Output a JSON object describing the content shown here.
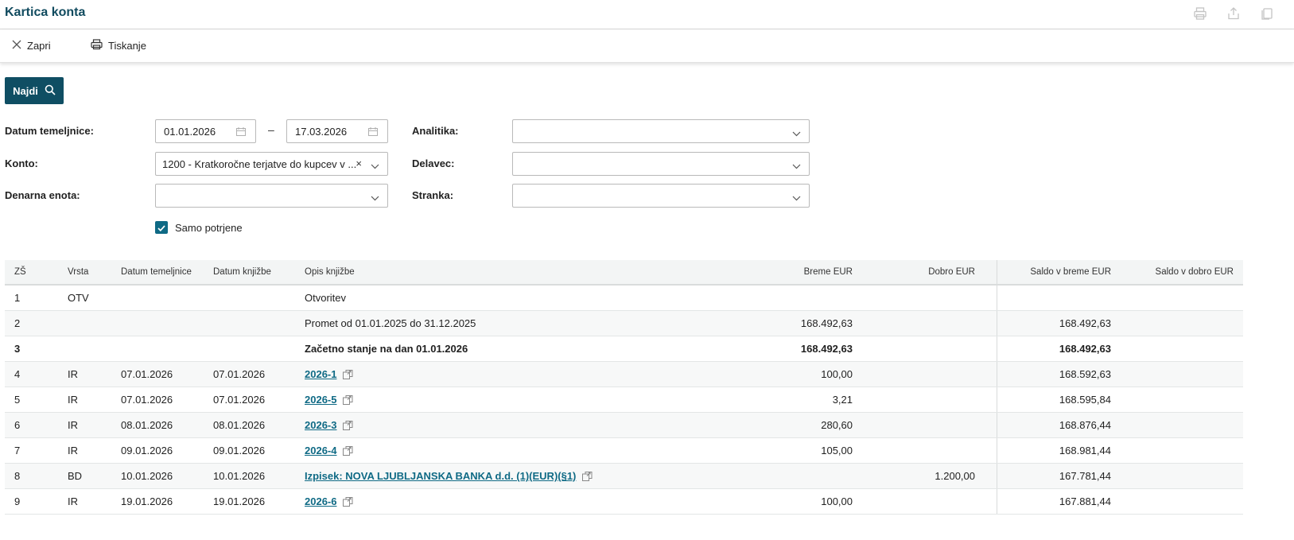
{
  "header": {
    "title": "Kartica konta",
    "icons": [
      "print-icon",
      "share-icon",
      "copy-icon"
    ]
  },
  "toolbar": {
    "close_label": "Zapri",
    "print_label": "Tiskanje"
  },
  "find_label": "Najdi",
  "filters": {
    "datum_label": "Datum temeljnice:",
    "date_from": "01.01.2026",
    "date_sep": "–",
    "date_to": "17.03.2026",
    "konto_label": "Konto:",
    "konto_value": "1200 - Kratkoročne terjatve do kupcev v ...",
    "clear_symbol": "×",
    "denarna_label": "Denarna enota:",
    "denarna_value": "",
    "analitika_label": "Analitika:",
    "analitika_value": "",
    "delavec_label": "Delavec:",
    "delavec_value": "",
    "stranka_label": "Stranka:",
    "stranka_value": "",
    "samo_potrjene_label": "Samo potrjene",
    "samo_potrjene_checked": true
  },
  "table": {
    "headers": {
      "zs": "ZŠ",
      "vrsta": "Vrsta",
      "datum_temeljnice": "Datum temeljnice",
      "datum_knjizbe": "Datum knjižbe",
      "opis": "Opis knjižbe",
      "breme": "Breme EUR",
      "dobro": "Dobro EUR",
      "saldo_breme": "Saldo v breme EUR",
      "saldo_dobro": "Saldo v dobro EUR"
    },
    "rows": [
      {
        "zs": "1",
        "vrsta": "OTV",
        "datum_temeljnice": "",
        "datum_knjizbe": "",
        "opis": "Otvoritev",
        "link": false,
        "breme": "",
        "dobro": "",
        "saldo_breme": "",
        "saldo_dobro": "",
        "bold": false
      },
      {
        "zs": "2",
        "vrsta": "",
        "datum_temeljnice": "",
        "datum_knjizbe": "",
        "opis": "Promet od 01.01.2025 do 31.12.2025",
        "link": false,
        "breme": "168.492,63",
        "dobro": "",
        "saldo_breme": "168.492,63",
        "saldo_dobro": "",
        "bold": false
      },
      {
        "zs": "3",
        "vrsta": "",
        "datum_temeljnice": "",
        "datum_knjizbe": "",
        "opis": "Začetno stanje na dan 01.01.2026",
        "link": false,
        "breme": "168.492,63",
        "dobro": "",
        "saldo_breme": "168.492,63",
        "saldo_dobro": "",
        "bold": true
      },
      {
        "zs": "4",
        "vrsta": "IR",
        "datum_temeljnice": "07.01.2026",
        "datum_knjizbe": "07.01.2026",
        "opis": "2026-1",
        "link": true,
        "breme": "100,00",
        "dobro": "",
        "saldo_breme": "168.592,63",
        "saldo_dobro": "",
        "bold": false
      },
      {
        "zs": "5",
        "vrsta": "IR",
        "datum_temeljnice": "07.01.2026",
        "datum_knjizbe": "07.01.2026",
        "opis": "2026-5",
        "link": true,
        "breme": "3,21",
        "dobro": "",
        "saldo_breme": "168.595,84",
        "saldo_dobro": "",
        "bold": false
      },
      {
        "zs": "6",
        "vrsta": "IR",
        "datum_temeljnice": "08.01.2026",
        "datum_knjizbe": "08.01.2026",
        "opis": "2026-3",
        "link": true,
        "breme": "280,60",
        "dobro": "",
        "saldo_breme": "168.876,44",
        "saldo_dobro": "",
        "bold": false
      },
      {
        "zs": "7",
        "vrsta": "IR",
        "datum_temeljnice": "09.01.2026",
        "datum_knjizbe": "09.01.2026",
        "opis": "2026-4",
        "link": true,
        "breme": "105,00",
        "dobro": "",
        "saldo_breme": "168.981,44",
        "saldo_dobro": "",
        "bold": false
      },
      {
        "zs": "8",
        "vrsta": "BD",
        "datum_temeljnice": "10.01.2026",
        "datum_knjizbe": "10.01.2026",
        "opis": "Izpisek: NOVA LJUBLJANSKA BANKA d.d. (1)(EUR)(§1)",
        "link": true,
        "breme": "",
        "dobro": "1.200,00",
        "saldo_breme": "167.781,44",
        "saldo_dobro": "",
        "bold": false
      },
      {
        "zs": "9",
        "vrsta": "IR",
        "datum_temeljnice": "19.01.2026",
        "datum_knjizbe": "19.01.2026",
        "opis": "2026-6",
        "link": true,
        "breme": "100,00",
        "dobro": "",
        "saldo_breme": "167.881,44",
        "saldo_dobro": "",
        "bold": false
      }
    ]
  }
}
